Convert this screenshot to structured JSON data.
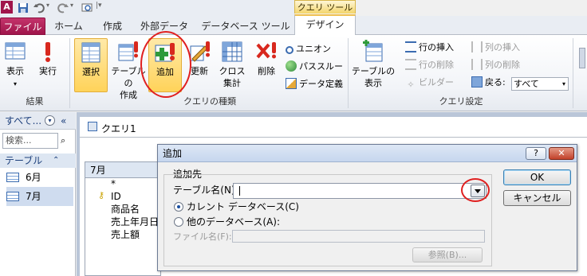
{
  "title_bar": {
    "context_tab": "クエリ ツール",
    "app_icon": "A"
  },
  "tabs": {
    "file": "ファイル",
    "home": "ホーム",
    "create": "作成",
    "external": "外部データ",
    "dbtools": "データベース ツール",
    "design": "デザイン"
  },
  "ribbon": {
    "view_label": "表示",
    "run_label": "実行",
    "results_group": "結果",
    "select_label": "選択",
    "maketable_label1": "テーブルの",
    "maketable_label2": "作成",
    "append_label": "追加",
    "update_label": "更新",
    "crosstab_label1": "クロス",
    "crosstab_label2": "集計",
    "delete_label": "削除",
    "union_label": "ユニオン",
    "passthrough_label": "パススルー",
    "datadef_label": "データ定義",
    "querytype_group": "クエリの種類",
    "showtable_label1": "テーブルの",
    "showtable_label2": "表示",
    "insert_rows": "行の挿入",
    "delete_rows": "行の削除",
    "builder": "ビルダー",
    "insert_cols": "列の挿入",
    "delete_cols": "列の削除",
    "return_label": "戻る:",
    "return_value": "すべて",
    "setup_group": "クエリ設定"
  },
  "nav": {
    "header": "すべて...",
    "search_placeholder": "検索...",
    "group": "テーブル",
    "items": [
      "6月",
      "7月"
    ]
  },
  "query": {
    "tab_label": "クエリ1",
    "table_name": "7月",
    "fields": [
      "*",
      "ID",
      "商品名",
      "売上年月日",
      "売上額"
    ]
  },
  "dialog": {
    "title": "追加",
    "section": "追加先",
    "table_name_label": "テーブル名(N):",
    "table_name_value": "",
    "current_db": "カレント データベース(C)",
    "other_db": "他のデータベース(A):",
    "file_name_label": "ファイル名(F):",
    "browse": "参照(B)...",
    "ok": "OK",
    "cancel": "キャンセル",
    "help_btn": "?",
    "close_btn": "✕"
  }
}
